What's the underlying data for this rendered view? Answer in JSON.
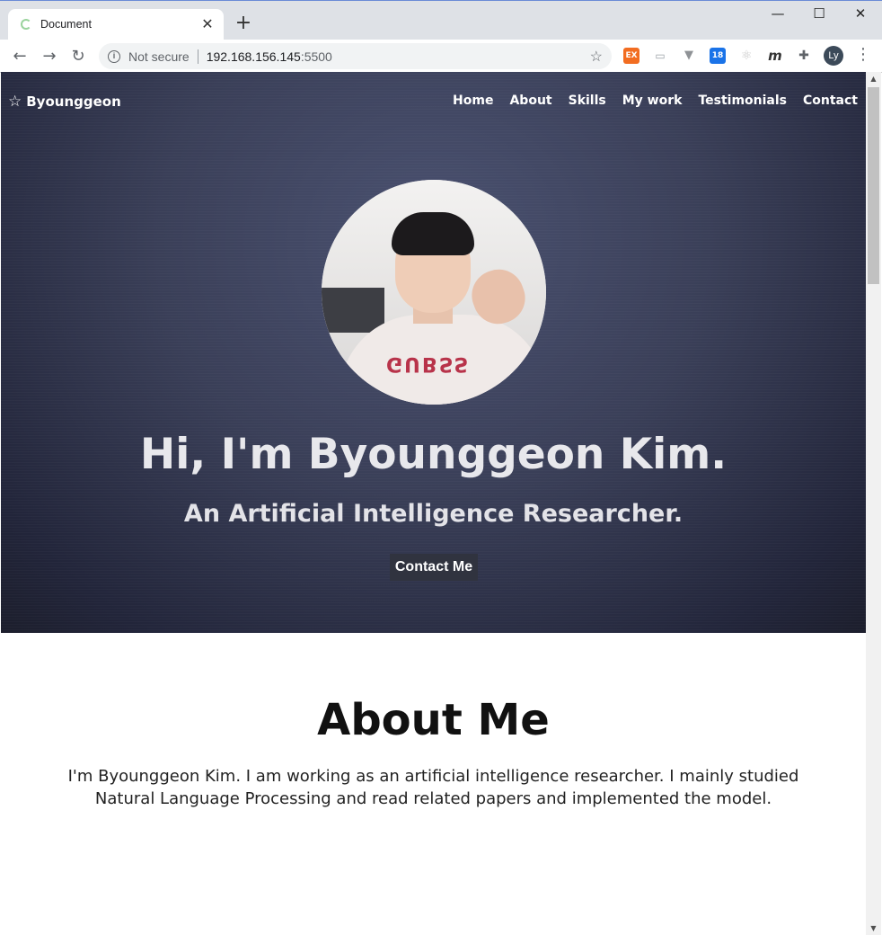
{
  "browser": {
    "tab_title": "Document",
    "tab_close": "✕",
    "new_tab": "+",
    "window_controls": {
      "minimize": "—",
      "maximize": "☐",
      "close": "✕"
    },
    "address": {
      "security_label": "Not secure",
      "host": "192.168.156.145",
      "port": ":5500"
    },
    "profile_initials": "Ly",
    "extensions": [
      {
        "name": "ex-extension-icon",
        "label": "EX",
        "color": "#f26d21"
      },
      {
        "name": "reader-extension-icon",
        "label": "▭",
        "color": "#9aa0a6"
      },
      {
        "name": "vue-devtools-icon",
        "label": "▼",
        "color": "#8f9296"
      },
      {
        "name": "tab-counter-icon",
        "label": "18",
        "color": "#1a73e8"
      },
      {
        "name": "react-devtools-icon",
        "label": "⚛",
        "color": "#c7c7c7"
      },
      {
        "name": "m-extension-icon",
        "label": "m",
        "color": "#333333"
      },
      {
        "name": "extensions-puzzle-icon",
        "label": "✚",
        "color": "#5f6368"
      }
    ]
  },
  "nav": {
    "brand": "Byounggeon",
    "items": [
      "Home",
      "About",
      "Skills",
      "My work",
      "Testimonials",
      "Contact"
    ]
  },
  "hero": {
    "title": "Hi, I'm Byounggeon Kim.",
    "subtitle": "An Artificial Intelligence Researcher.",
    "cta": "Contact Me",
    "shirt_print": "GUBSS"
  },
  "about": {
    "heading": "About Me",
    "body": "I'm Byounggeon Kim. I am working as an artificial intelligence researcher. I mainly studied Natural Language Processing and read related papers and implemented the model."
  }
}
